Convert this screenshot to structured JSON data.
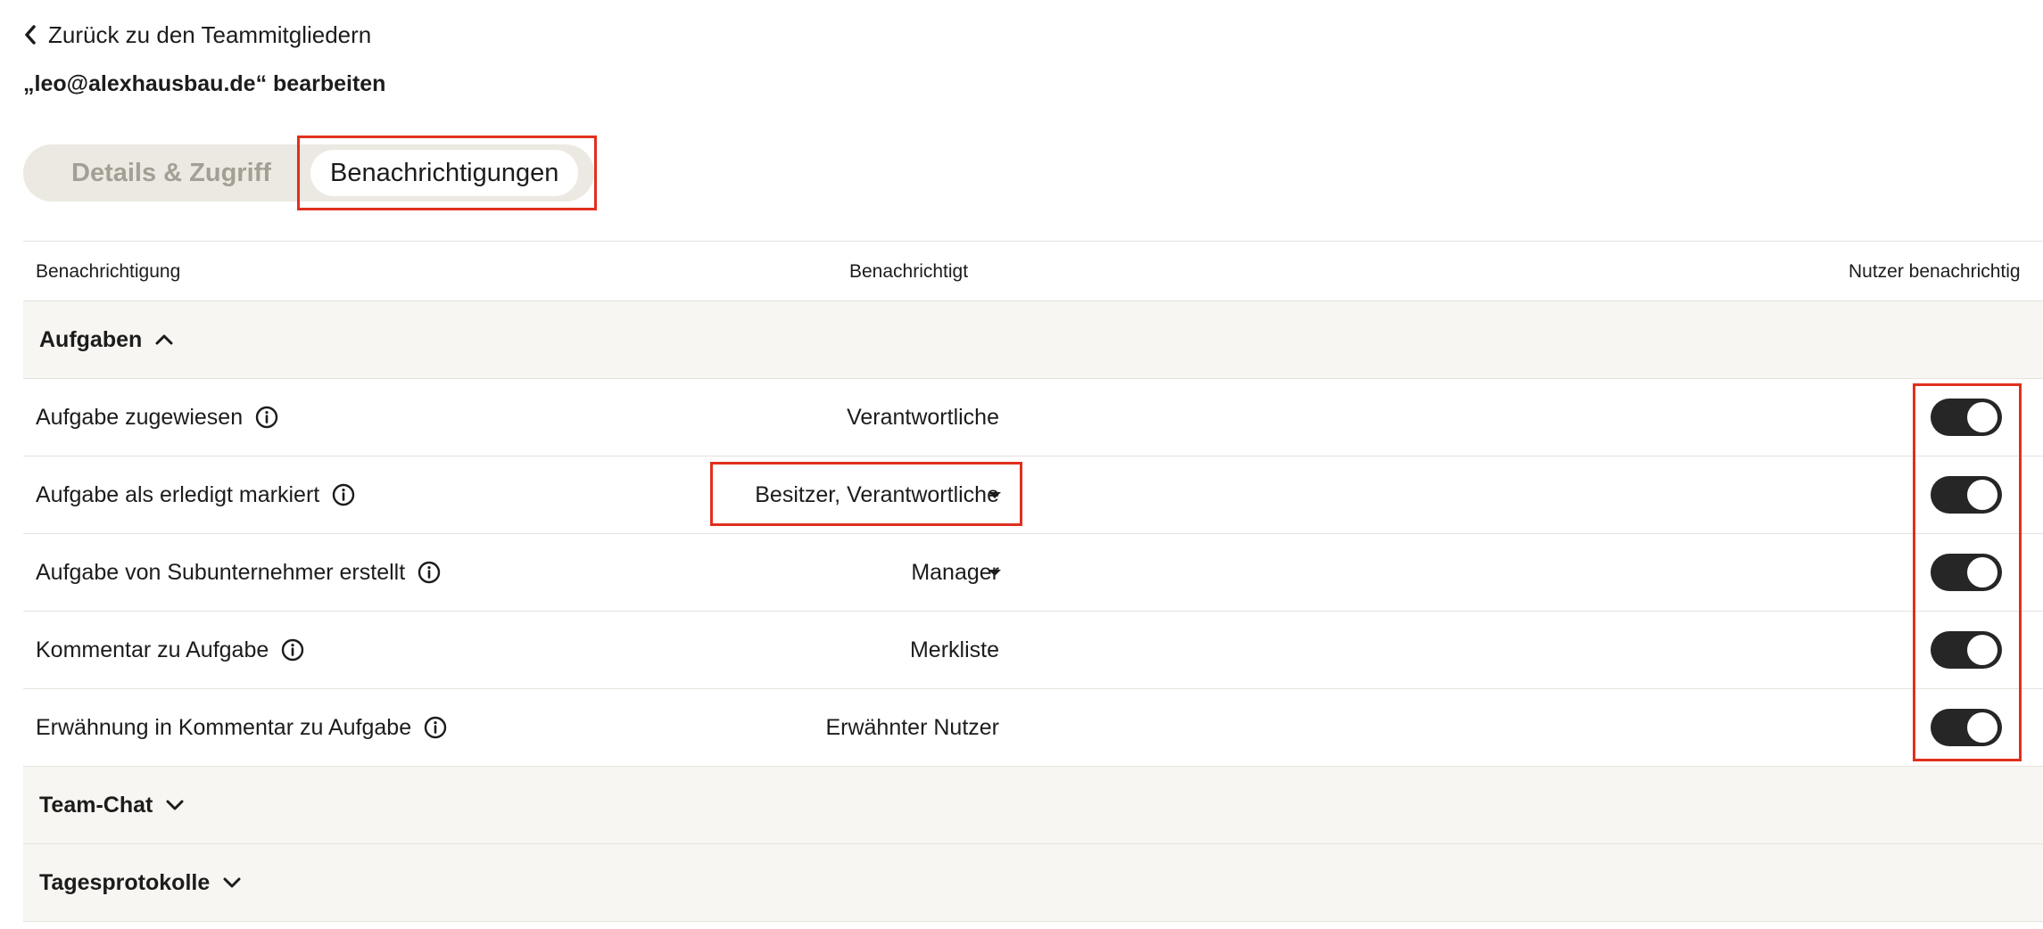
{
  "nav": {
    "back_label": "Zurück zu den Teammitgliedern"
  },
  "page_title": "„leo@alexhausbau.de“ bearbeiten",
  "tabs": [
    {
      "label": "Details & Zugriff",
      "active": false
    },
    {
      "label": "Benachrichtigungen",
      "active": true
    }
  ],
  "table": {
    "headers": {
      "notification": "Benachrichtigung",
      "notified": "Benachrichtigt",
      "notify_user": "Nutzer benachrichtig"
    },
    "sections": [
      {
        "title": "Aufgaben",
        "expanded": true,
        "rows": [
          {
            "name": "Aufgabe zugewiesen",
            "notified": "Verantwortliche",
            "dropdown": false,
            "enabled": true
          },
          {
            "name": "Aufgabe als erledigt markiert",
            "notified": "Besitzer, Verantwortliche",
            "dropdown": true,
            "enabled": true
          },
          {
            "name": "Aufgabe von Subunternehmer erstellt",
            "notified": "Manager",
            "dropdown": true,
            "enabled": true
          },
          {
            "name": "Kommentar zu Aufgabe",
            "notified": "Merkliste",
            "dropdown": false,
            "enabled": true
          },
          {
            "name": "Erwähnung in Kommentar zu Aufgabe",
            "notified": "Erwähnter Nutzer",
            "dropdown": false,
            "enabled": true
          }
        ]
      },
      {
        "title": "Team-Chat",
        "expanded": false
      },
      {
        "title": "Tagesprotokolle",
        "expanded": false
      }
    ]
  },
  "colors": {
    "highlight": "#e0301e",
    "toggle_on": "#262626",
    "section_bg": "#f7f6f2"
  },
  "icons": {
    "back": "chevron-left-icon",
    "info": "info-circle-icon",
    "expanded": "chevron-up-icon",
    "collapsed": "chevron-down-icon",
    "dropdown": "caret-down-icon"
  }
}
